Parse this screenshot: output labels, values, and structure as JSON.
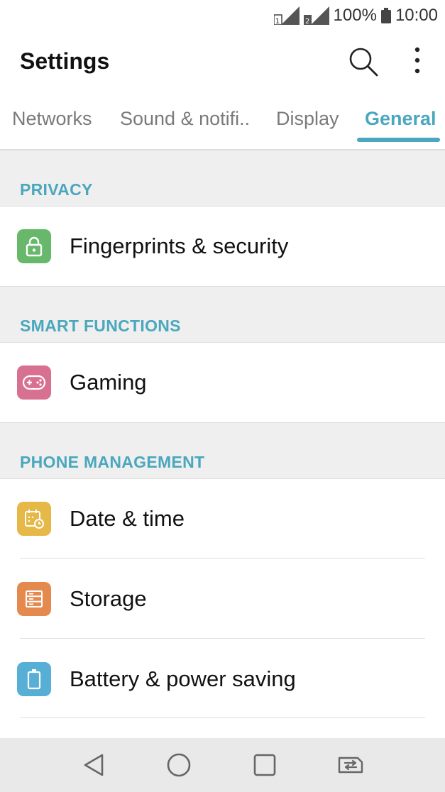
{
  "status_bar": {
    "battery": "100%",
    "time": "10:00",
    "sim1_badge": "1",
    "sim2_badge": "2"
  },
  "app_bar": {
    "title": "Settings"
  },
  "tabs": [
    {
      "label": "Networks",
      "active": false
    },
    {
      "label": "Sound & notifi..",
      "active": false
    },
    {
      "label": "Display",
      "active": false
    },
    {
      "label": "General",
      "active": true
    }
  ],
  "sections": [
    {
      "header": "PRIVACY",
      "items": [
        {
          "label": "Fingerprints & security",
          "icon": "lock-icon",
          "color": "#67b86a"
        }
      ]
    },
    {
      "header": "SMART FUNCTIONS",
      "items": [
        {
          "label": "Gaming",
          "icon": "gamepad-icon",
          "color": "#d8718f"
        }
      ]
    },
    {
      "header": "PHONE MANAGEMENT",
      "items": [
        {
          "label": "Date & time",
          "icon": "calendar-clock-icon",
          "color": "#e5b848"
        },
        {
          "label": "Storage",
          "icon": "storage-icon",
          "color": "#e58a4e"
        },
        {
          "label": "Battery & power saving",
          "icon": "battery-icon",
          "color": "#58afd6"
        }
      ]
    }
  ],
  "colors": {
    "accent": "#4aa7bd",
    "section_background": "#efefef"
  }
}
